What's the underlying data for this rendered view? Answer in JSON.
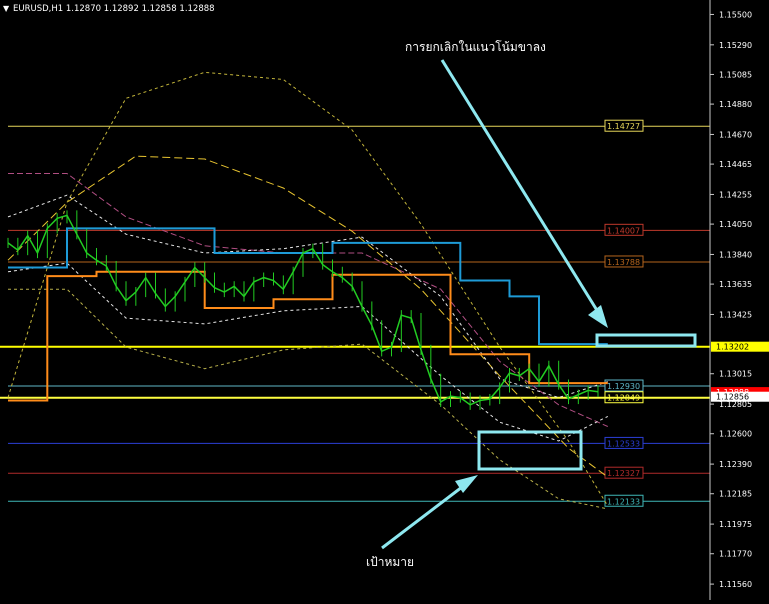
{
  "header": {
    "arrow": "▼",
    "symbol_text": "EURUSD,H1  1.12870 1.12892 1.12858 1.12888"
  },
  "annotations": {
    "downtrend_note": "การยกเลิกในแนวโน้มขาลง",
    "target_note": "เป้าหมาย"
  },
  "chart_data": {
    "type": "line",
    "ylim": [
      1.1145,
      1.156
    ],
    "y_ticks": [
      {
        "label": "1.15500",
        "value": 1.155
      },
      {
        "label": "1.15290",
        "value": 1.1529
      },
      {
        "label": "1.15085",
        "value": 1.15085
      },
      {
        "label": "1.14880",
        "value": 1.1488
      },
      {
        "label": "1.14670",
        "value": 1.1467
      },
      {
        "label": "1.14465",
        "value": 1.14465
      },
      {
        "label": "1.14255",
        "value": 1.14255
      },
      {
        "label": "1.14050",
        "value": 1.1405
      },
      {
        "label": "1.13840",
        "value": 1.1384
      },
      {
        "label": "1.13635",
        "value": 1.13635
      },
      {
        "label": "1.13425",
        "value": 1.13425
      },
      {
        "label": "1.13015",
        "value": 1.13015
      },
      {
        "label": "1.12805",
        "value": 1.12805
      },
      {
        "label": "1.12600",
        "value": 1.126
      },
      {
        "label": "1.12390",
        "value": 1.1239
      },
      {
        "label": "1.12185",
        "value": 1.12185
      },
      {
        "label": "1.11975",
        "value": 1.11975
      },
      {
        "label": "1.11770",
        "value": 1.1177
      },
      {
        "label": "1.11560",
        "value": 1.1156
      }
    ],
    "price_badges": [
      {
        "label": "1.13202",
        "value": 1.13202,
        "bg": "#ffff00",
        "fg": "#000000"
      },
      {
        "label": "1.12888",
        "value": 1.12888,
        "bg": "#ff0000",
        "fg": "#ffffff"
      },
      {
        "label": "1.12856",
        "value": 1.12856,
        "bg": "#ffffff",
        "fg": "#000000"
      }
    ],
    "levels": [
      {
        "label": "1.14727",
        "value": 1.14727,
        "color": "#e6d65a"
      },
      {
        "label": "1.14007",
        "value": 1.14007,
        "color": "#c0392b"
      },
      {
        "label": "1.13788",
        "value": 1.13788,
        "color": "#b5651d"
      },
      {
        "label": "1.12930",
        "value": 1.1293,
        "color": "#5fb8c9"
      },
      {
        "label": "1.12849",
        "value": 1.12849,
        "color": "#ffff40"
      },
      {
        "label": "1.12533",
        "value": 1.12533,
        "color": "#2b3fd6"
      },
      {
        "label": "1.12327",
        "value": 1.12327,
        "color": "#b02a2a"
      },
      {
        "label": "1.12133",
        "value": 1.12133,
        "color": "#3fb7b7"
      }
    ],
    "resistance_line": {
      "value": 1.13202,
      "color": "#ffff00"
    },
    "price_series": {
      "name": "",
      "color": "#22cc22",
      "values": [
        1.1392,
        1.1387,
        1.1397,
        1.1385,
        1.1402,
        1.1409,
        1.1411,
        1.1398,
        1.1385,
        1.138,
        1.1376,
        1.1362,
        1.1352,
        1.1358,
        1.1368,
        1.1357,
        1.1348,
        1.1355,
        1.1365,
        1.1375,
        1.1368,
        1.1361,
        1.1358,
        1.1362,
        1.1355,
        1.1365,
        1.1368,
        1.1366,
        1.136,
        1.1372,
        1.1385,
        1.1388,
        1.1377,
        1.1372,
        1.1368,
        1.1362,
        1.1348,
        1.1335,
        1.1317,
        1.132,
        1.1342,
        1.134,
        1.1318,
        1.1298,
        1.1282,
        1.1286,
        1.1285,
        1.128,
        1.1283,
        1.1284,
        1.1292,
        1.1302,
        1.13,
        1.1305,
        1.1296,
        1.1307,
        1.1294,
        1.1284,
        1.1287,
        1.129,
        1.1289
      ]
    },
    "step_lines": [
      {
        "name": "",
        "color": "#1e9bd7",
        "points": [
          [
            0,
            1.1375
          ],
          [
            6,
            1.1375
          ],
          [
            6,
            1.1402
          ],
          [
            12,
            1.1402
          ],
          [
            12,
            1.1402
          ],
          [
            21,
            1.1402
          ],
          [
            21,
            1.1385
          ],
          [
            33,
            1.1385
          ],
          [
            33,
            1.1392
          ],
          [
            46,
            1.1392
          ],
          [
            46,
            1.1366
          ],
          [
            51,
            1.1366
          ],
          [
            51,
            1.1355
          ],
          [
            54,
            1.1355
          ],
          [
            54,
            1.1322
          ],
          [
            61,
            1.1322
          ]
        ]
      },
      {
        "name": "",
        "color": "#ff8c1a",
        "points": [
          [
            0,
            1.1283
          ],
          [
            4,
            1.1283
          ],
          [
            4,
            1.1369
          ],
          [
            9,
            1.1369
          ],
          [
            9,
            1.1372
          ],
          [
            20,
            1.1372
          ],
          [
            20,
            1.1347
          ],
          [
            27,
            1.1347
          ],
          [
            27,
            1.1353
          ],
          [
            33,
            1.1353
          ],
          [
            33,
            1.137
          ],
          [
            45,
            1.137
          ],
          [
            45,
            1.1315
          ],
          [
            53,
            1.1315
          ],
          [
            53,
            1.1295
          ],
          [
            61,
            1.1295
          ]
        ]
      }
    ],
    "dashed_curves": [
      {
        "name": "",
        "color": "#c2b43a",
        "dash": "3,3",
        "points": [
          [
            0,
            1.1285
          ],
          [
            6,
            1.142
          ],
          [
            12,
            1.1492
          ],
          [
            20,
            1.151
          ],
          [
            28,
            1.1505
          ],
          [
            35,
            1.147
          ],
          [
            42,
            1.1405
          ],
          [
            50,
            1.132
          ],
          [
            57,
            1.1255
          ],
          [
            61,
            1.121
          ]
        ]
      },
      {
        "name": "",
        "color": "#e8c430",
        "dash": "8,4",
        "points": [
          [
            0,
            1.138
          ],
          [
            6,
            1.142
          ],
          [
            13,
            1.1452
          ],
          [
            20,
            1.145
          ],
          [
            28,
            1.143
          ],
          [
            35,
            1.14
          ],
          [
            42,
            1.136
          ],
          [
            50,
            1.13
          ],
          [
            57,
            1.125
          ],
          [
            61,
            1.123
          ]
        ]
      },
      {
        "name": "",
        "color": "#b04e82",
        "dash": "6,3",
        "points": [
          [
            0,
            1.144
          ],
          [
            6,
            1.144
          ],
          [
            12,
            1.141
          ],
          [
            20,
            1.139
          ],
          [
            28,
            1.1385
          ],
          [
            36,
            1.1385
          ],
          [
            44,
            1.136
          ],
          [
            50,
            1.131
          ],
          [
            56,
            1.128
          ],
          [
            61,
            1.1265
          ]
        ]
      },
      {
        "name": "",
        "color": "#e6e6e6",
        "dash": "3,3",
        "points": [
          [
            0,
            1.141
          ],
          [
            6,
            1.1425
          ],
          [
            12,
            1.1398
          ],
          [
            20,
            1.1385
          ],
          [
            28,
            1.1388
          ],
          [
            36,
            1.1396
          ],
          [
            44,
            1.1355
          ],
          [
            50,
            1.1298
          ],
          [
            56,
            1.1285
          ],
          [
            61,
            1.1296
          ]
        ]
      },
      {
        "name": "",
        "color": "#e6e6e6",
        "dash": "3,3",
        "points": [
          [
            0,
            1.1372
          ],
          [
            6,
            1.1378
          ],
          [
            12,
            1.134
          ],
          [
            20,
            1.1336
          ],
          [
            28,
            1.1345
          ],
          [
            36,
            1.1348
          ],
          [
            44,
            1.13
          ],
          [
            50,
            1.1268
          ],
          [
            56,
            1.1255
          ],
          [
            61,
            1.1272
          ]
        ]
      },
      {
        "name": "",
        "color": "#b8b04a",
        "dash": "3,3",
        "points": [
          [
            0,
            1.136
          ],
          [
            6,
            1.136
          ],
          [
            12,
            1.132
          ],
          [
            20,
            1.1305
          ],
          [
            28,
            1.1318
          ],
          [
            36,
            1.1322
          ],
          [
            44,
            1.128
          ],
          [
            50,
            1.1242
          ],
          [
            56,
            1.1215
          ],
          [
            61,
            1.1208
          ]
        ]
      }
    ]
  }
}
